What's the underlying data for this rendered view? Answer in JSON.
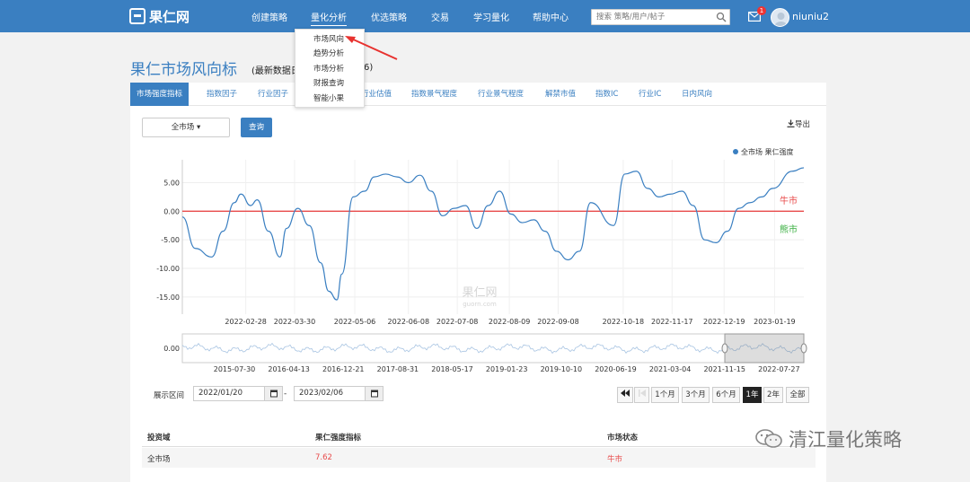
{
  "nav": {
    "logo": "果仁网",
    "items": [
      "创建策略",
      "量化分析",
      "优选策略",
      "交易",
      "学习量化",
      "帮助中心"
    ],
    "search_placeholder": "搜索 策略/用户/帖子",
    "notification_count": "1",
    "username": "niuniu2"
  },
  "dropdown": {
    "items": [
      "市场风向",
      "趋势分析",
      "市场分析",
      "财报查询",
      "智能小果"
    ]
  },
  "page": {
    "title": "果仁市场风向标",
    "subtitle": "(最新数据日",
    "subtitle_tail": "6)"
  },
  "tabs": [
    "市场强度指标",
    "指数因子",
    "行业因子",
    "行业估值",
    "指数景气程度",
    "行业景气程度",
    "解禁市值",
    "指数IC",
    "行业IC",
    "日内风向"
  ],
  "controls": {
    "market_select": "全市场",
    "query_label": "查询",
    "export_label": "导出",
    "range_label": "展示区间",
    "date_from": "2022/01/20",
    "date_to": "2023/02/06",
    "zoom_buttons": [
      "1个月",
      "3个月",
      "6个月",
      "1年",
      "2年",
      "全部"
    ],
    "active_zoom": "1年"
  },
  "chart_data": {
    "type": "line",
    "legend": "全市场 果仁强度",
    "legend_position": "top-right",
    "ylim": [
      -18,
      9
    ],
    "yticks": [
      5,
      0,
      -5,
      -10,
      -15
    ],
    "ytick_labels": [
      "5.00",
      "0.00",
      "-5.00",
      "-10.00",
      "-15.00"
    ],
    "xlim": [
      "2022-01-20",
      "2023-02-06"
    ],
    "xtick_labels": [
      "2022-02-28",
      "2022-03-30",
      "2022-05-06",
      "2022-06-08",
      "2022-07-08",
      "2022-08-09",
      "2022-09-08",
      "2022-10-18",
      "2022-11-17",
      "2022-12-19",
      "2023-01-19"
    ],
    "reference_line": {
      "y": 0,
      "color": "#e84a4a"
    },
    "annotations": [
      {
        "text": "牛市",
        "color": "#e84a4a"
      },
      {
        "text": "熊市",
        "color": "#3cb043"
      }
    ],
    "watermark": "果仁网",
    "watermark_sub": "guorn.com",
    "series": [
      {
        "name": "全市场 果仁强度",
        "color": "#3a7fc1",
        "x": [
          "2022-01-20",
          "2022-01-28",
          "2022-02-07",
          "2022-02-14",
          "2022-02-21",
          "2022-02-25",
          "2022-03-03",
          "2022-03-07",
          "2022-03-14",
          "2022-03-21",
          "2022-03-25",
          "2022-04-01",
          "2022-04-08",
          "2022-04-15",
          "2022-04-20",
          "2022-04-25",
          "2022-04-28",
          "2022-05-05",
          "2022-05-12",
          "2022-05-18",
          "2022-05-25",
          "2022-06-01",
          "2022-06-08",
          "2022-06-15",
          "2022-06-22",
          "2022-06-29",
          "2022-07-06",
          "2022-07-13",
          "2022-07-20",
          "2022-07-27",
          "2022-08-03",
          "2022-08-10",
          "2022-08-17",
          "2022-08-24",
          "2022-08-31",
          "2022-09-07",
          "2022-09-14",
          "2022-09-21",
          "2022-09-28",
          "2022-10-12",
          "2022-10-19",
          "2022-10-26",
          "2022-11-02",
          "2022-11-09",
          "2022-11-16",
          "2022-11-23",
          "2022-11-30",
          "2022-12-07",
          "2022-12-14",
          "2022-12-21",
          "2022-12-28",
          "2023-01-04",
          "2023-01-11",
          "2023-01-18",
          "2023-01-30",
          "2023-02-06"
        ],
        "values": [
          -1.0,
          -6.5,
          -8.0,
          -3.5,
          1.5,
          3.0,
          1.0,
          2.0,
          -3.5,
          -8.0,
          -3.0,
          0.5,
          -2.5,
          -9.0,
          -14.0,
          -15.5,
          -11.0,
          2.5,
          3.5,
          6.0,
          6.5,
          6.0,
          5.0,
          6.3,
          3.5,
          -0.8,
          0.5,
          1.0,
          -3.0,
          1.0,
          3.5,
          -0.5,
          -2.0,
          -1.5,
          -3.5,
          -7.0,
          -8.5,
          -7.0,
          1.5,
          -2.5,
          6.5,
          7.0,
          4.0,
          2.5,
          3.0,
          3.5,
          1.0,
          -5.0,
          -5.5,
          -3.5,
          0.5,
          1.5,
          2.5,
          4.0,
          7.0,
          7.6
        ]
      }
    ],
    "navigator": {
      "ytick_label": "0.00",
      "xtick_labels": [
        "2015-07-30",
        "2016-04-13",
        "2016-12-21",
        "2017-08-31",
        "2018-05-17",
        "2019-01-23",
        "2019-10-10",
        "2020-06-19",
        "2021-03-04",
        "2021-11-15",
        "2022-07-27"
      ]
    }
  },
  "result_table": {
    "headers": [
      "投资域",
      "果仁强度指标",
      "市场状态"
    ],
    "rows": [
      [
        "全市场",
        "7.62",
        "牛市"
      ]
    ]
  },
  "watermark": {
    "text": "清江量化策略"
  }
}
